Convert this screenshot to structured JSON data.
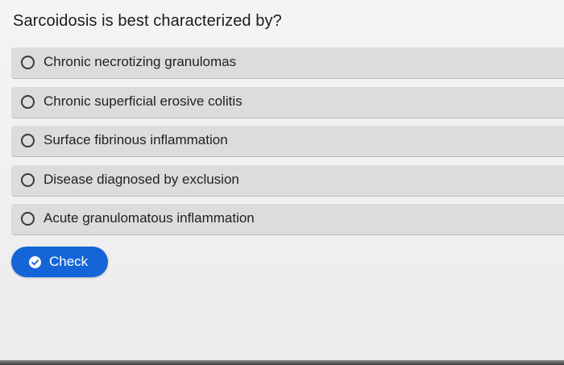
{
  "question": {
    "text": "Sarcoidosis is best characterized by?"
  },
  "options": [
    {
      "label": "Chronic necrotizing granulomas",
      "selected": false
    },
    {
      "label": "Chronic superficial erosive colitis",
      "selected": false
    },
    {
      "label": "Surface fibrinous inflammation",
      "selected": false
    },
    {
      "label": "Disease diagnosed by exclusion",
      "selected": false
    },
    {
      "label": "Acute granulomatous inflammation",
      "selected": false
    }
  ],
  "check_button": {
    "label": "Check",
    "icon": "check-circle-icon"
  },
  "colors": {
    "accent": "#1565d8",
    "option_background": "#dcdcde",
    "page_background": "#f2f2f4"
  }
}
